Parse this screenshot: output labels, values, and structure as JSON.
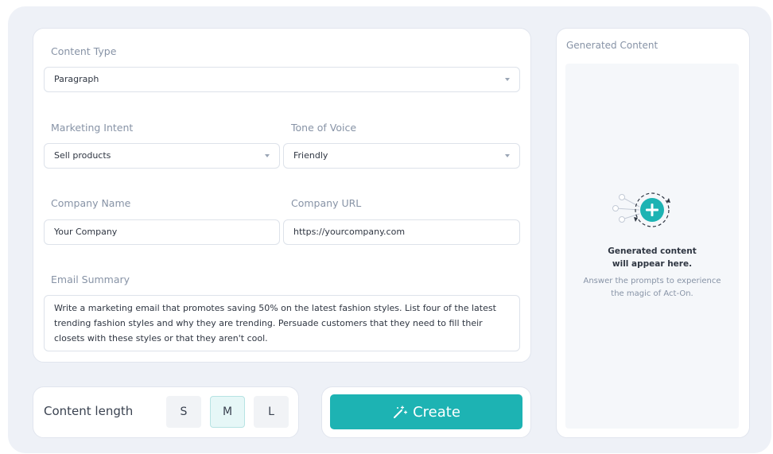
{
  "form": {
    "content_type_label": "Content Type",
    "content_type_value": "Paragraph",
    "marketing_intent_label": "Marketing Intent",
    "marketing_intent_value": "Sell products",
    "tone_label": "Tone of Voice",
    "tone_value": "Friendly",
    "company_name_label": "Company Name",
    "company_name_value": "Your Company",
    "company_url_label": "Company URL",
    "company_url_value": "https://yourcompany.com",
    "email_summary_label": "Email Summary",
    "email_summary_value": "Write a marketing email that promotes saving 50% on the latest fashion styles. List four of the latest trending fashion styles and why they are trending. Persuade customers that they need to fill their closets with these styles or that they aren't cool."
  },
  "generated": {
    "title": "Generated Content",
    "heading_line1": "Generated content",
    "heading_line2": "will appear here.",
    "sub_line1": "Answer the prompts to experience",
    "sub_line2": "the magic of Act-On."
  },
  "length": {
    "label": "Content length",
    "options": [
      "S",
      "M",
      "L"
    ],
    "selected": "M"
  },
  "create": {
    "label": "Create",
    "icon": "magic-wand-icon"
  },
  "colors": {
    "accent": "#1db3b3",
    "background": "#eef1f7",
    "muted_text": "#8793a6"
  }
}
